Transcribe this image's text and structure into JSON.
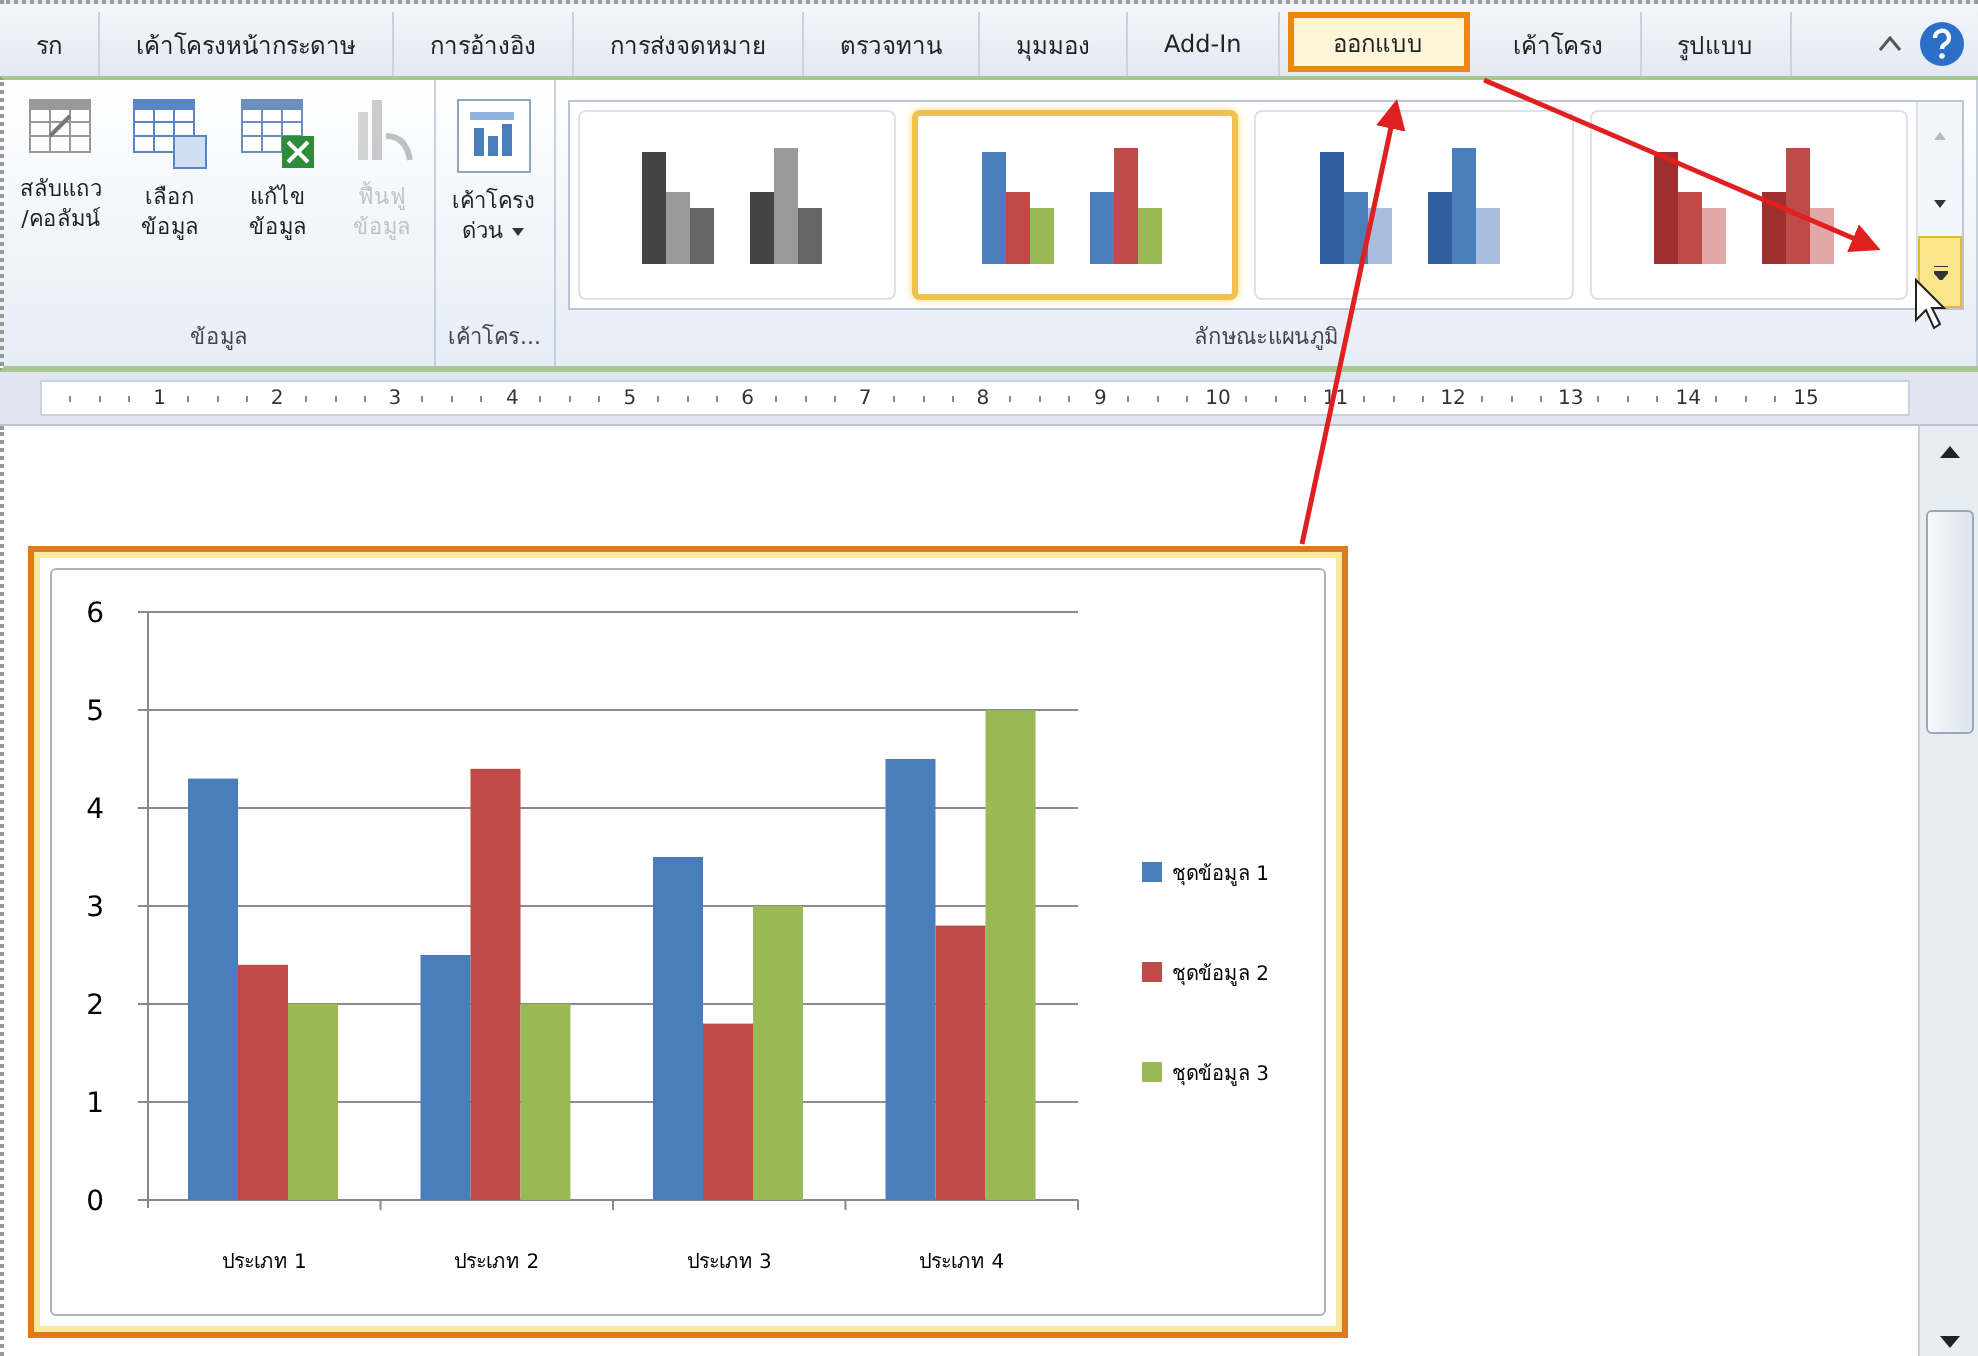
{
  "tabs": [
    {
      "label": "รก",
      "selected": false
    },
    {
      "label": "เค้าโครงหน้ากระดาษ",
      "selected": false
    },
    {
      "label": "การอ้างอิง",
      "selected": false
    },
    {
      "label": "การส่งจดหมาย",
      "selected": false
    },
    {
      "label": "ตรวจทาน",
      "selected": false
    },
    {
      "label": "มุมมอง",
      "selected": false
    },
    {
      "label": "Add-In",
      "selected": false
    },
    {
      "label": "ออกแบบ",
      "selected": true
    },
    {
      "label": "เค้าโครง",
      "selected": false
    },
    {
      "label": "รูปแบบ",
      "selected": false
    }
  ],
  "ribbon_groups": [
    {
      "kind": "buttons",
      "label": "ข้อมูล",
      "buttons": [
        {
          "kind": "switch-row-column",
          "lines": [
            "สลับแถว",
            "/คอลัมน์"
          ],
          "disabled": false
        },
        {
          "kind": "select-data",
          "lines": [
            "เลือก",
            "ข้อมูล"
          ],
          "disabled": false
        },
        {
          "kind": "edit-data",
          "lines": [
            "แก้ไข",
            "ข้อมูล"
          ],
          "disabled": false
        },
        {
          "kind": "refresh-data",
          "lines": [
            "ฟื้นฟู",
            "ข้อมูล"
          ],
          "disabled": true
        }
      ]
    },
    {
      "kind": "buttons",
      "label": "เค้าโคร...",
      "buttons": [
        {
          "kind": "quick-layout",
          "lines": [
            "เค้าโครง",
            "ด่วน"
          ],
          "disabled": false,
          "dropdown": true
        }
      ]
    },
    {
      "kind": "gallery",
      "label": "ลักษณะแผนภูมิ",
      "more_hovered": true,
      "styles": [
        {
          "kind": "gray",
          "selected": false
        },
        {
          "kind": "colorful",
          "selected": true
        },
        {
          "kind": "blue",
          "selected": false
        },
        {
          "kind": "red",
          "selected": false
        }
      ]
    }
  ],
  "ruler": {
    "marks": [
      "1",
      "2",
      "3",
      "4",
      "5",
      "6",
      "7",
      "8",
      "9",
      "10",
      "11",
      "12",
      "13",
      "14",
      "15"
    ]
  },
  "chart": {
    "chart_data": {
      "type": "bar",
      "grid": true,
      "legend": true,
      "categories": [
        "ประเภท 1",
        "ประเภท 2",
        "ประเภท 3",
        "ประเภท 4"
      ],
      "ylim": [
        0,
        6
      ],
      "yticks": [
        0,
        1,
        2,
        3,
        4,
        5,
        6
      ],
      "series": [
        {
          "name": "ชุดข้อมูล 1",
          "color": "#4a7ebb",
          "values": [
            4.3,
            2.5,
            3.5,
            4.5
          ]
        },
        {
          "name": "ชุดข้อมูล 2",
          "color": "#be4b48",
          "values": [
            2.4,
            4.4,
            1.8,
            2.8
          ]
        },
        {
          "name": "ชุดข้อมูล 3",
          "color": "#98b954",
          "values": [
            2,
            2,
            3,
            5
          ]
        }
      ]
    }
  }
}
